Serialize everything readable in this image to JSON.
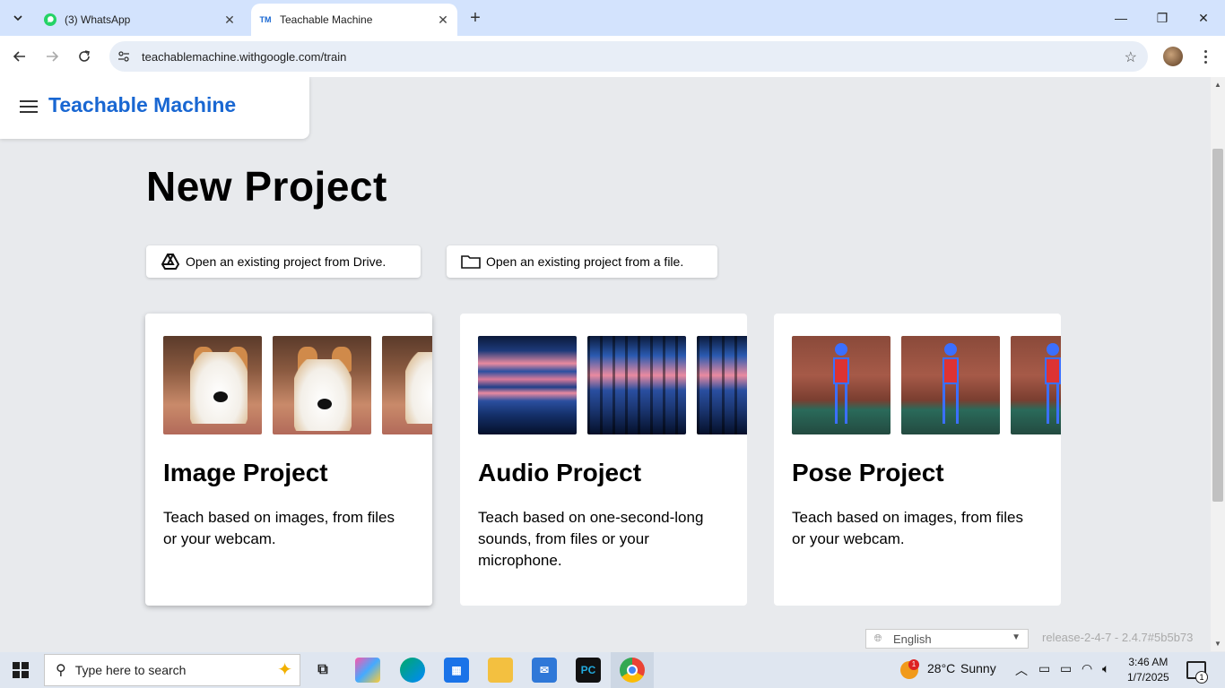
{
  "browser": {
    "tabs": [
      {
        "title": "(3) WhatsApp"
      },
      {
        "title": "Teachable Machine",
        "favicon_text": "TM"
      }
    ],
    "url": "teachablemachine.withgoogle.com/train"
  },
  "header": {
    "brand": "Teachable Machine"
  },
  "main": {
    "title": "New Project",
    "open_drive_label": "Open an existing project from Drive.",
    "open_file_label": "Open an existing project from a file."
  },
  "cards": [
    {
      "title": "Image Project",
      "description": "Teach based on images, from files or your webcam."
    },
    {
      "title": "Audio Project",
      "description": "Teach based on one-second-long sounds, from files or your microphone."
    },
    {
      "title": "Pose Project",
      "description": "Teach based on images, from files or your webcam."
    }
  ],
  "footer": {
    "language": "English",
    "release": "release-2-4-7 - 2.4.7#5b5b73"
  },
  "taskbar": {
    "search_placeholder": "Type here to search",
    "weather_temp": "28°C",
    "weather_text": "Sunny",
    "weather_badge": "1",
    "time": "3:46 AM",
    "date": "1/7/2025",
    "notification_count": "1"
  },
  "colors": {
    "brand": "#1967d2",
    "tabbar": "#d3e3fd",
    "page_bg": "#e8eaed"
  }
}
